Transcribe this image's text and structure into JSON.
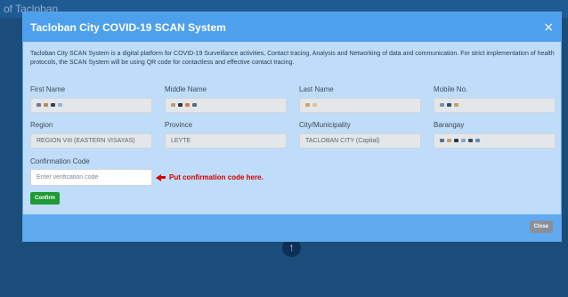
{
  "backdrop": {
    "title_fragment": "of Tacloban"
  },
  "modal": {
    "title": "Tacloban City COVID-19 SCAN System",
    "intro": "Tacloban City SCAN System is a digital platform for COVID-19 Surveillance activities, Contact tracing, Analysis and Networking of data and communication. For strict implementation of health protocols, the SCAN System will be using QR code for contactless and effective contact tracing."
  },
  "fields": {
    "first_name": {
      "label": "First Name",
      "value": ""
    },
    "middle_name": {
      "label": "Middle Name",
      "value": ""
    },
    "last_name": {
      "label": "Last Name",
      "value": ""
    },
    "mobile_no": {
      "label": "Mobile No.",
      "value": ""
    },
    "region": {
      "label": "Region",
      "value": "REGION VIII (EASTERN VISAYAS)"
    },
    "province": {
      "label": "Province",
      "value": "LEYTE"
    },
    "city": {
      "label": "City/Municipality",
      "value": "TACLOBAN CITY (Capital)"
    },
    "barangay": {
      "label": "Barangay",
      "value": ""
    }
  },
  "confirmation": {
    "label": "Confirmation Code",
    "placeholder": "Enter verification code",
    "hint": "Put confirmation code here.",
    "button": "Confirm"
  },
  "footer": {
    "close_button": "Close"
  },
  "colors": {
    "header": "#4da0ec",
    "body": "#bfdcf8",
    "confirm_button": "#1e9a35",
    "close_button": "#8a9099",
    "hint": "#d40000"
  },
  "icons": {
    "close": "close-icon",
    "arrow": "arrow-left-icon",
    "page": "arrow-up-icon"
  }
}
